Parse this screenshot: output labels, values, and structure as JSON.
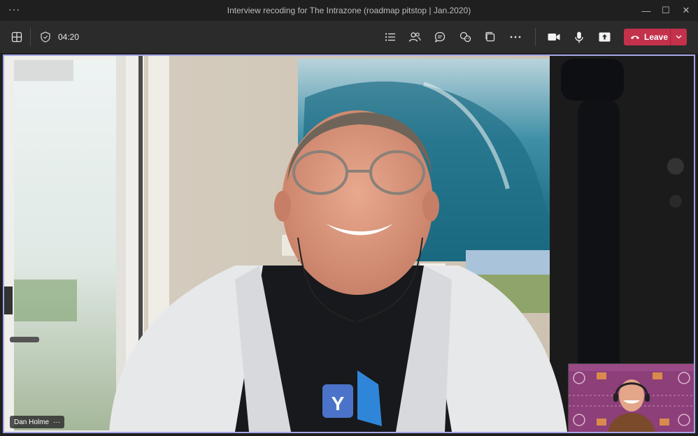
{
  "window": {
    "menu_label": "···",
    "title": "Interview recoding for The Intrazone (roadmap pitstop | Jan.2020)",
    "controls": {
      "minimize": "—",
      "maximize": "☐",
      "close": "✕"
    }
  },
  "toolbar": {
    "timer": "04:20",
    "leave_label": "Leave",
    "icons": [
      "grid-icon",
      "shield-icon",
      "list-icon",
      "people-icon",
      "chat-icon",
      "reactions-icon",
      "rooms-icon",
      "more-icon",
      "camera-icon",
      "mic-icon",
      "share-icon"
    ]
  },
  "participant": {
    "name": "Dan Holme",
    "more": "···"
  },
  "colors": {
    "accent": "#a4a7e8",
    "leave": "#c4314b",
    "toolbar_bg": "#2b2b2b",
    "titlebar_bg": "#1f1f1f"
  }
}
